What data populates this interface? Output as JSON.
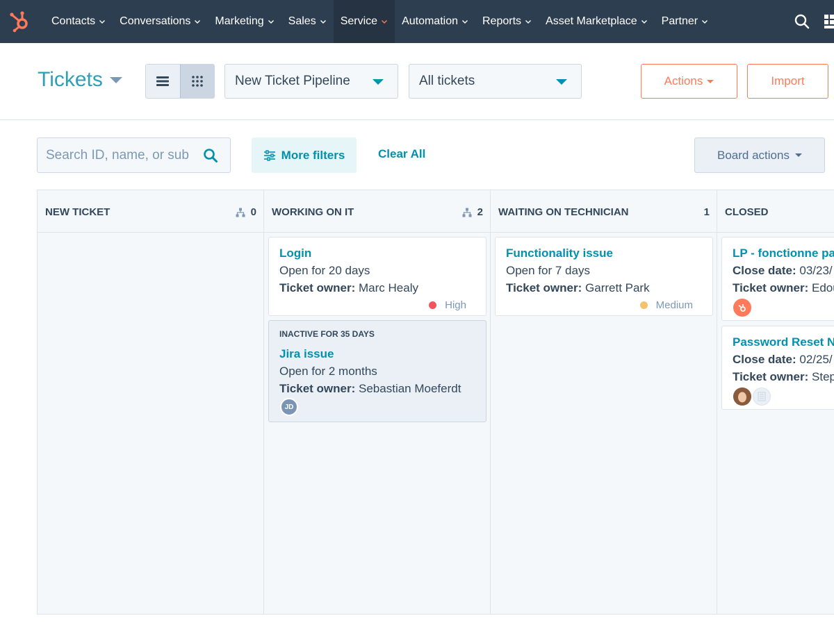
{
  "nav": {
    "logo_icon": "hubspot-sprocket-icon",
    "items": [
      {
        "label": "Contacts",
        "active": false
      },
      {
        "label": "Conversations",
        "active": false
      },
      {
        "label": "Marketing",
        "active": false
      },
      {
        "label": "Sales",
        "active": false
      },
      {
        "label": "Service",
        "active": true
      },
      {
        "label": "Automation",
        "active": false
      },
      {
        "label": "Reports",
        "active": false
      },
      {
        "label": "Asset Marketplace",
        "active": false
      },
      {
        "label": "Partner",
        "active": false
      }
    ],
    "search_icon": "search-icon",
    "apps_icon": "marketplace-icon"
  },
  "header": {
    "title": "Tickets",
    "pipeline": "New Ticket Pipeline",
    "view_filter": "All tickets",
    "actions_label": "Actions",
    "import_label": "Import"
  },
  "filters": {
    "search_placeholder": "Search ID, name, or sub",
    "more_filters_label": "More filters",
    "clear_all_label": "Clear All",
    "board_actions_label": "Board actions"
  },
  "board": {
    "columns": [
      {
        "name": "NEW TICKET",
        "count": "0",
        "cards": []
      },
      {
        "name": "WORKING ON IT",
        "count": "2",
        "cards": [
          {
            "title": "Login",
            "line1": "Open for 20 days",
            "owner_label": "Ticket owner:",
            "owner": "Marc Healy",
            "priority": "High",
            "priority_color": "#f2545b"
          },
          {
            "inactive": "INACTIVE FOR 35 DAYS",
            "title": "Jira issue",
            "line1": "Open for 2 months",
            "owner_label": "Ticket owner:",
            "owner": "Sebastian Moeferdt",
            "avatar": "JD"
          }
        ]
      },
      {
        "name": "WAITING ON TECHNICIAN",
        "count": "1",
        "cards": [
          {
            "title": "Functionality issue",
            "line1": "Open for 7 days",
            "owner_label": "Ticket owner:",
            "owner": "Garrett Park",
            "priority": "Medium",
            "priority_color": "#f5c26b"
          }
        ]
      },
      {
        "name": "CLOSED",
        "count": "",
        "cards": [
          {
            "title": "LP - fonctionne pas",
            "close_label": "Close date:",
            "close_date": "03/23/",
            "owner_label": "Ticket owner:",
            "owner": "Edou"
          },
          {
            "title": "Password Reset No",
            "close_label": "Close date:",
            "close_date": "02/25/",
            "owner_label": "Ticket owner:",
            "owner": "Step"
          }
        ]
      }
    ]
  },
  "colors": {
    "nav_bg": "#2d3e50",
    "accent": "#0091ae",
    "title": "#2e9fb5",
    "orange": "#ff7a59"
  }
}
